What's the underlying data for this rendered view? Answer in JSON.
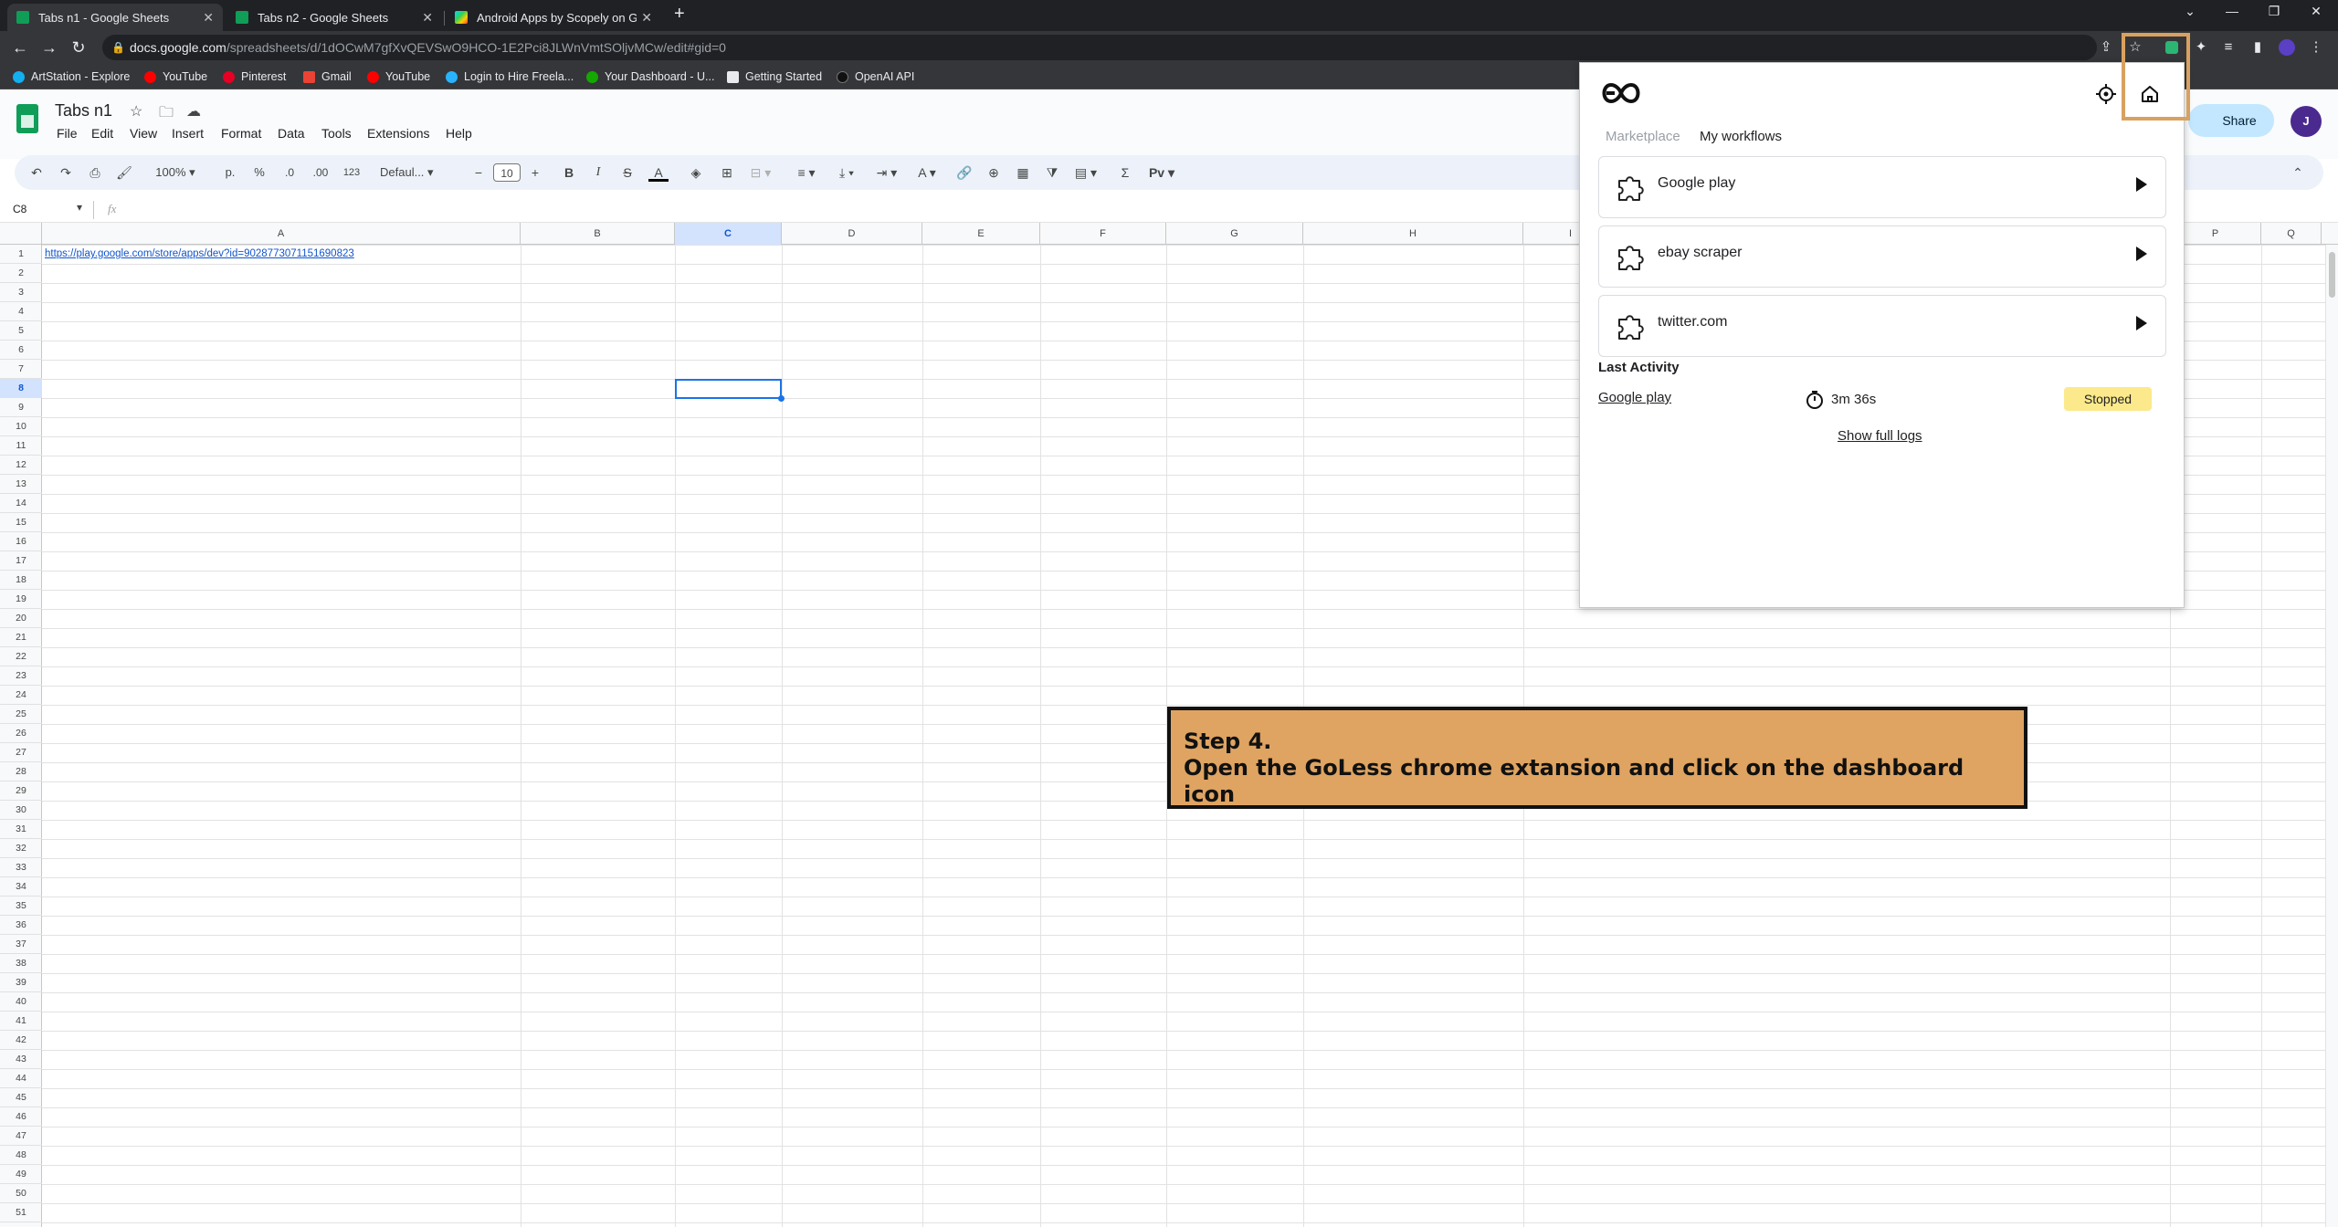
{
  "browser": {
    "tabs": [
      {
        "label": "Tabs n1 - Google Sheets",
        "active": true,
        "icon": "google-sheets-icon"
      },
      {
        "label": "Tabs n2 - Google Sheets",
        "active": false,
        "icon": "google-sheets-icon"
      },
      {
        "label": "Android Apps by Scopely on Go",
        "active": false,
        "icon": "google-play-icon"
      }
    ],
    "new_tab_label": "+",
    "url_host": "docs.google.com",
    "url_path": "/spreadsheets/d/1dOCwM7gfXvQEVSwO9HCO-1E2Pci8JLWnVmtSOljvMCw/edit#gid=0",
    "bookmarks": [
      {
        "label": "ArtStation - Explore",
        "color": "#13aff0"
      },
      {
        "label": "YouTube",
        "color": "#ff0000"
      },
      {
        "label": "Pinterest",
        "color": "#e60023"
      },
      {
        "label": "Gmail",
        "color": "#ea4335"
      },
      {
        "label": "YouTube",
        "color": "#ff0000"
      },
      {
        "label": "Login to Hire Freela...",
        "color": "#29b2fe"
      },
      {
        "label": "Your Dashboard - U...",
        "color": "#14a800"
      },
      {
        "label": "Getting Started",
        "color": "#e8eaed"
      },
      {
        "label": "OpenAI API",
        "color": "#111111"
      }
    ]
  },
  "sheets": {
    "doc_title": "Tabs n1",
    "menu": [
      "File",
      "Edit",
      "View",
      "Insert",
      "Format",
      "Data",
      "Tools",
      "Extensions",
      "Help"
    ],
    "share_label": "Share",
    "avatar_letter": "J",
    "toolbar": {
      "zoom": "100%",
      "currency": "р.",
      "percent": "%",
      "dec_less": ".0",
      "dec_more": ".00",
      "number_format": "123",
      "font": "Defaul...",
      "font_size": "10",
      "bold": "B",
      "italic": "I"
    },
    "name_box": "C8",
    "fx_label": "fx",
    "columns": [
      "A",
      "B",
      "C",
      "D",
      "E",
      "F",
      "G",
      "H",
      "I",
      "P",
      "Q"
    ],
    "selected_column": "C",
    "selected_row": 8,
    "row_count": 51,
    "cell_a1": "https://play.google.com/store/apps/dev?id=9028773071151690823"
  },
  "callout": {
    "line1": "Step 4.",
    "line2": "Open the GoLess chrome extansion and click on the dashboard icon",
    "bg_color": "#dfa462"
  },
  "extension": {
    "tabs": [
      "Marketplace",
      "My workflows"
    ],
    "active_tab": "My workflows",
    "workflows": [
      "Google play",
      "ebay scraper",
      "twitter.com"
    ],
    "last_activity_heading": "Last Activity",
    "last_activity": {
      "name": "Google play",
      "duration": "3m 36s",
      "status": "Stopped"
    },
    "show_logs": "Show full logs",
    "status_color": "#fbe98b"
  }
}
